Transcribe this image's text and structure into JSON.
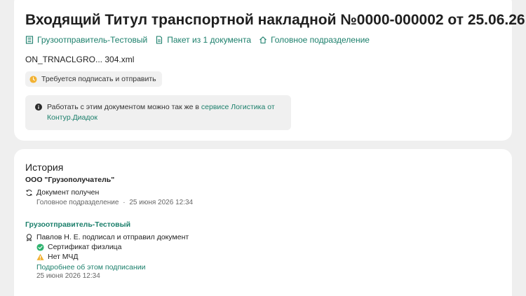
{
  "document": {
    "title": "Входящий Титул транспортной накладной №0000-000002 от 25.06.26",
    "meta": {
      "sender": "Грузоотправитель-Тестовый",
      "package": "Пакет из 1 документа",
      "department": "Головное подразделение"
    },
    "file_name": "ON_TRNACLGRO... 304.xml",
    "status": "Требуется подписать и отправить",
    "info": {
      "text_before": "Работать с этим документом можно так же в",
      "link_text": "сервисе Логистика от Контур.Диадок"
    }
  },
  "history": {
    "title": "История",
    "receiver_org": "ООО \"Грузополучатель\"",
    "received": {
      "action": "Документ получен",
      "department": "Головное подразделение",
      "separator": "·",
      "timestamp": "25 июня 2026 12:34"
    },
    "sender_org": "Грузоотправитель-Тестовый",
    "signed": {
      "action": "Павлов Н. Е. подписал и отправил документ",
      "certificate": "Сертификат физлица",
      "mchd": "Нет МЧД",
      "details_link": "Подробнее об этом подписании",
      "timestamp": "25 июня 2026 12:34"
    }
  },
  "colors": {
    "accent": "#1b7f6b",
    "warning": "#f2b233",
    "success": "#2fb36f",
    "background": "#efefef"
  },
  "icons": {
    "sender": "building-icon",
    "package": "document-icon",
    "department": "home-icon",
    "status": "clock-icon",
    "info": "info-icon",
    "received": "sync-icon",
    "signed": "signature-badge-icon",
    "certificate": "check-circle-icon",
    "mchd": "warning-triangle-icon"
  }
}
